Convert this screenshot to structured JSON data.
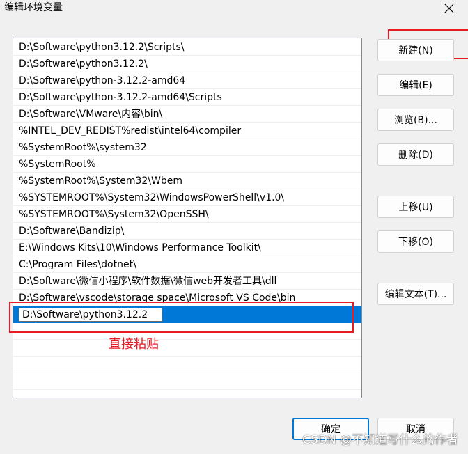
{
  "window": {
    "title": "编辑环境变量",
    "close_icon": "close-icon"
  },
  "path_list": {
    "items": [
      "D:\\Software\\python3.12.2\\Scripts\\",
      "D:\\Software\\python3.12.2\\",
      "D:\\Software\\python-3.12.2-amd64",
      "D:\\Software\\python-3.12.2-amd64\\Scripts",
      "D:\\Software\\VMware\\内容\\bin\\",
      "%INTEL_DEV_REDIST%redist\\intel64\\compiler",
      "%SystemRoot%\\system32",
      "%SystemRoot%",
      "%SystemRoot%\\System32\\Wbem",
      "%SYSTEMROOT%\\System32\\WindowsPowerShell\\v1.0\\",
      "%SYSTEMROOT%\\System32\\OpenSSH\\",
      "D:\\Software\\Bandizip\\",
      "E:\\Windows Kits\\10\\Windows Performance Toolkit\\",
      "C:\\Program Files\\dotnet\\",
      "D:\\Software\\微信小程序\\软件数据\\微信web开发者工具\\dll",
      "D:\\Software\\vscode\\storage space\\Microsoft VS Code\\bin"
    ],
    "editing_value": "D:\\Software\\python3.12.2"
  },
  "annotation": {
    "text": "直接粘贴",
    "color": "#e81b23"
  },
  "buttons": {
    "new": "新建(N)",
    "edit": "编辑(E)",
    "browse": "浏览(B)...",
    "delete": "删除(D)",
    "move_up": "上移(U)",
    "move_down": "下移(O)",
    "edit_text": "编辑文本(T)...",
    "ok": "确定",
    "cancel": "取消"
  },
  "watermark": "CSDN @不知道写什么的作者",
  "colors": {
    "selection": "#0078d7",
    "dialog_bg": "#f0f0f0",
    "annotation": "#e81b23"
  }
}
